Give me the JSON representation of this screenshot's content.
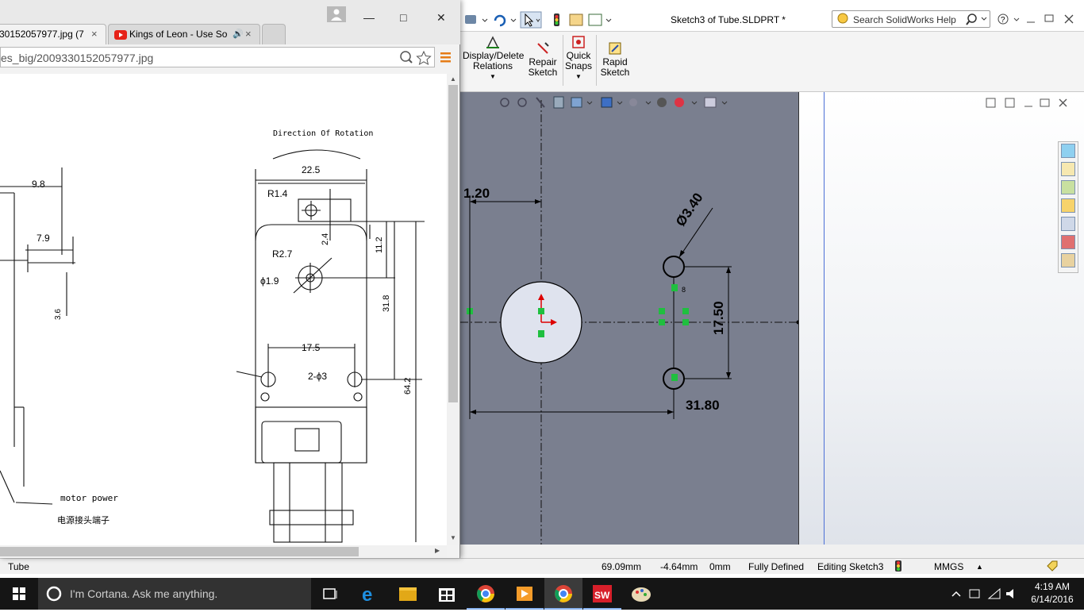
{
  "solidworks": {
    "title": "Sketch3 of Tube.SLDPRT *",
    "search_placeholder": "Search SolidWorks Help",
    "commands": [
      {
        "label1": "Display/Delete",
        "label2": "Relations"
      },
      {
        "label1": "Repair",
        "label2": "Sketch"
      },
      {
        "label1": "Quick",
        "label2": "Snaps"
      },
      {
        "label1": "Rapid",
        "label2": "Sketch"
      }
    ],
    "dimensions": {
      "d1": "1.20",
      "d2": "Ø3.40",
      "d3": "17.50",
      "d4": "31.80"
    },
    "status": {
      "part": "Tube",
      "x": "69.09mm",
      "y": "-4.64mm",
      "z": "0mm",
      "state": "Fully Defined",
      "mode": "Editing Sketch3",
      "units": "MMGS"
    }
  },
  "chrome": {
    "tabs": [
      {
        "label": "30152057977.jpg (7",
        "close": "×"
      },
      {
        "label": "Kings of Leon - Use So",
        "close": "×"
      }
    ],
    "url": "es_big/2009330152057977.jpg",
    "drawing": {
      "rotation_label": "Direction Of Rotation",
      "dims": [
        "22.5",
        "R1.4",
        "2.4",
        "11.2",
        "R2.7",
        "ϕ1.9",
        "31.8",
        "17.5",
        "2-ϕ3",
        "64.2",
        "9.8",
        "7.9",
        "3.6"
      ],
      "motor_power_en": "motor power",
      "motor_power_cn": "电源接头端子"
    }
  },
  "taskbar": {
    "cortana": "I'm Cortana. Ask me anything.",
    "time": "4:19 AM",
    "date": "6/14/2016"
  }
}
